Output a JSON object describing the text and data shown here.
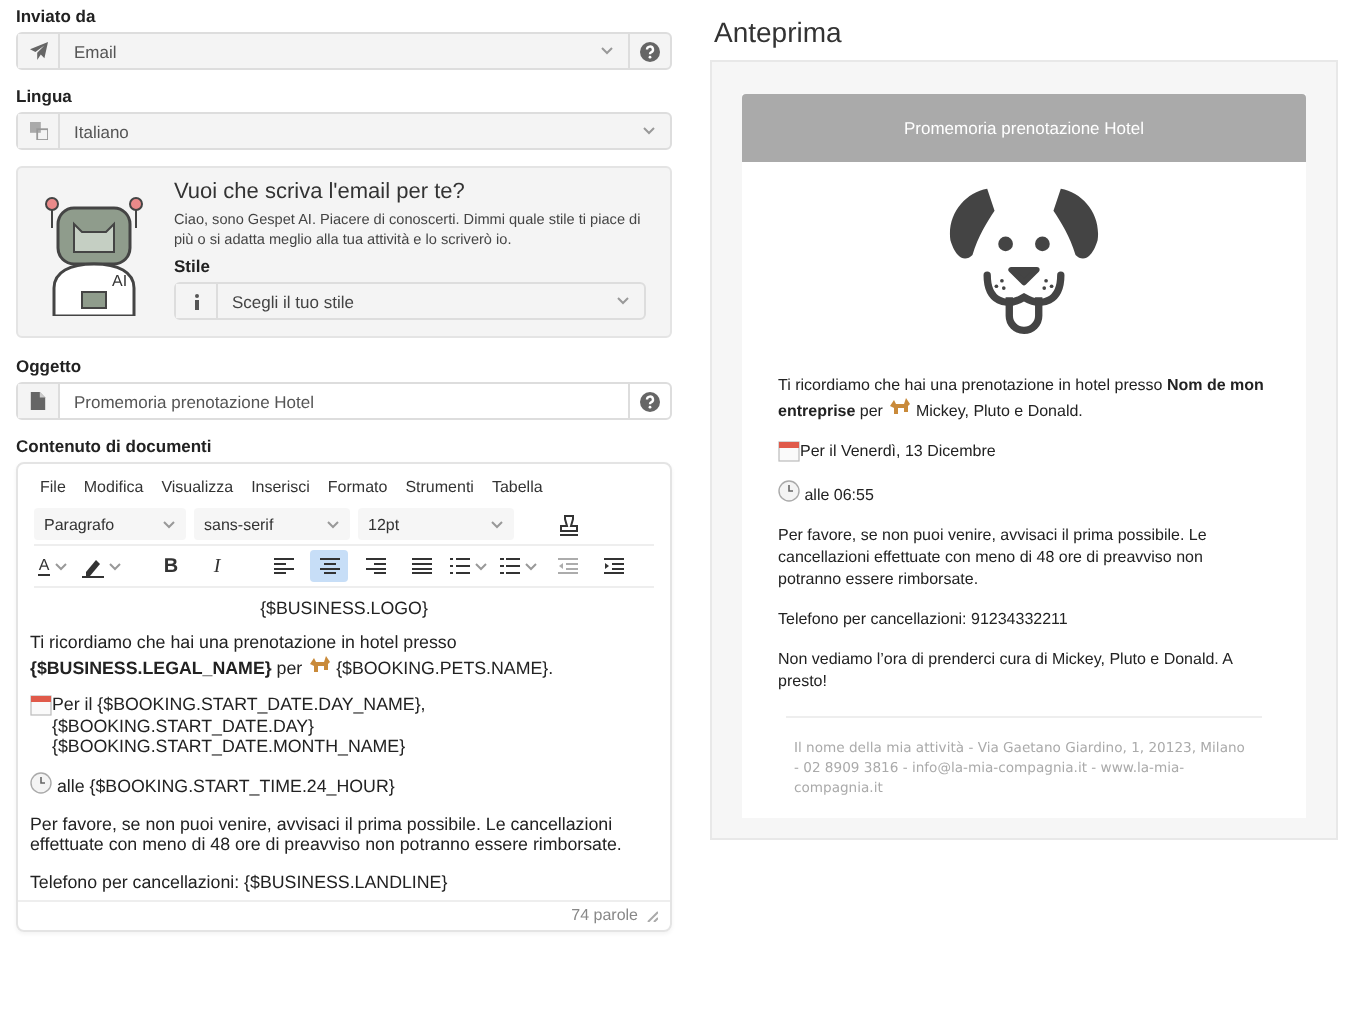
{
  "sender": {
    "label": "Inviato da",
    "value": "Email"
  },
  "language": {
    "label": "Lingua",
    "value": "Italiano"
  },
  "ai_box": {
    "title": "Vuoi che scriva l'email per te?",
    "text": "Ciao, sono Gespet AI. Piacere di conoscerti. Dimmi quale stile ti piace di più o si adatta meglio alla tua attività e lo scriverò io.",
    "robot_badge": "AI",
    "style_label": "Stile",
    "style_placeholder": "Scegli il tuo stile"
  },
  "subject": {
    "label": "Oggetto",
    "value": "Promemoria prenotazione Hotel"
  },
  "editor": {
    "label": "Contenuto di documenti",
    "menu": [
      "File",
      "Modifica",
      "Visualizza",
      "Inserisci",
      "Formato",
      "Strumenti",
      "Tabella"
    ],
    "format_selects": [
      "Paragrafo",
      "sans-serif",
      "12pt"
    ],
    "toolbar": [
      {
        "kind": "text-color",
        "glyph": "A",
        "selected": false,
        "disabled": false
      },
      {
        "kind": "highlight",
        "selected": false,
        "disabled": false
      },
      {
        "kind": "bold",
        "glyph": "B",
        "selected": false,
        "disabled": false
      },
      {
        "kind": "italic",
        "glyph": "I",
        "selected": false,
        "disabled": false
      },
      {
        "kind": "align-left",
        "selected": false,
        "disabled": false
      },
      {
        "kind": "align-center",
        "selected": true,
        "disabled": false
      },
      {
        "kind": "align-right",
        "selected": false,
        "disabled": false
      },
      {
        "kind": "justify",
        "selected": false,
        "disabled": false
      },
      {
        "kind": "bullet-list",
        "selected": false,
        "disabled": false
      },
      {
        "kind": "numbered-list",
        "selected": false,
        "disabled": false
      },
      {
        "kind": "outdent",
        "selected": false,
        "disabled": true
      },
      {
        "kind": "indent",
        "selected": false,
        "disabled": false
      }
    ],
    "content": [
      {
        "kind": "logo",
        "text": "{$BUSINESS.LOGO}"
      },
      {
        "kind": "pets",
        "text": "Ti ricordiamo che hai una prenotazione in hotel presso",
        "text_lead": "**{$BUSINESS.LEGAL_NAME}** per",
        "text_after": "{$BOOKING.PETS.NAME}."
      },
      {
        "kind": "date",
        "text": "Per il {$BOOKING.START_DATE.DAY_NAME}, {$BOOKING.START_DATE.DAY} {$BOOKING.START_DATE.MONTH_NAME}"
      },
      {
        "kind": "time",
        "text": "alle {$BOOKING.START_TIME.24_HOUR}"
      },
      {
        "kind": "text",
        "text": "Per favore, se non puoi venire, avvisaci il prima possibile. Le cancellazioni effettuate con meno di 48 ore di preavviso non potranno essere rimborsate."
      },
      {
        "kind": "text",
        "text": "Telefono per cancellazioni: {$BUSINESS.LANDLINE}"
      }
    ],
    "word_count": "74 parole"
  },
  "preview": {
    "title": "Anteprima",
    "email_header": "Promemoria prenotazione Hotel",
    "content": [
      {
        "kind": "logo"
      },
      {
        "kind": "pets",
        "text": "Ti ricordiamo che hai una prenotazione in hotel presso **Nom de mon**",
        "text_lead": "**entreprise** per",
        "text_after": "Mickey, Pluto e Donald."
      },
      {
        "kind": "date",
        "text": "Per il Venerdì, 13 Dicembre"
      },
      {
        "kind": "time",
        "text": "alle 06:55"
      },
      {
        "kind": "text",
        "text": "Per favore, se non puoi venire, avvisaci il prima possibile. Le cancellazioni effettuate con meno di 48 ore di preavviso non potranno essere rimborsate."
      },
      {
        "kind": "text",
        "text": "Telefono per cancellazioni: 91234332211"
      },
      {
        "kind": "text",
        "text": "Non vediamo l’ora di prenderci cura di Mickey, Pluto e Donald. A presto!"
      }
    ],
    "footer": "Il nome della mia attività - Via Gaetano Giardino, 1, 20123, Milano - 02 8909 3816 - info@la-mia-compagnia.it - www.la-mia-compagnia.it"
  }
}
